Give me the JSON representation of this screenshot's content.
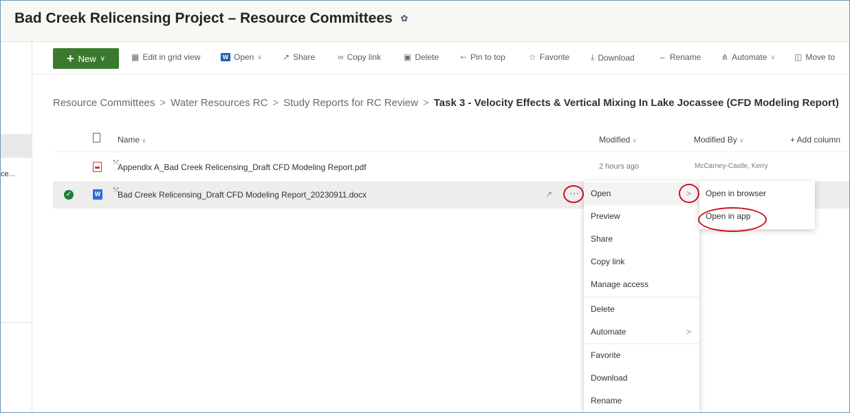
{
  "site": {
    "title": "Bad Creek Relicensing Project – Resource Committees"
  },
  "left_rail": {
    "truncated_item": "ce..."
  },
  "toolbar": {
    "new_label": "New",
    "edit_grid": "Edit in grid view",
    "open": "Open",
    "share": "Share",
    "copy_link": "Copy link",
    "delete": "Delete",
    "pin": "Pin to top",
    "favorite": "Favorite",
    "download": "Download",
    "rename": "Rename",
    "automate": "Automate",
    "move": "Move to"
  },
  "breadcrumb": {
    "items": [
      "Resource Committees",
      "Water Resources RC",
      "Study Reports for RC Review"
    ],
    "current": "Task 3 - Velocity Effects & Vertical Mixing In Lake Jocassee (CFD Modeling Report)"
  },
  "columns": {
    "name": "Name",
    "modified": "Modified",
    "modified_by": "Modified By",
    "add_column": "+ Add column"
  },
  "files": [
    {
      "name": "Appendix A_Bad Creek Relicensing_Draft CFD Modeling Report.pdf",
      "modified": "2 hours ago",
      "modified_by": "McCarney-Castle, Kerry",
      "type": "pdf"
    },
    {
      "name": "Bad Creek Relicensing_Draft CFD Modeling Report_20230911.docx",
      "modified": "",
      "modified_by": "",
      "type": "docx",
      "selected": true
    }
  ],
  "context_menu": {
    "items": [
      "Open",
      "Preview",
      "Share",
      "Copy link",
      "Manage access",
      "Delete",
      "Automate",
      "Favorite",
      "Download",
      "Rename"
    ]
  },
  "submenu": {
    "items": [
      "Open in browser",
      "Open in app"
    ]
  },
  "colors": {
    "brand_green": "#3a7a2e",
    "annotation_red": "#cc1020",
    "selected_row": "#ededed"
  }
}
